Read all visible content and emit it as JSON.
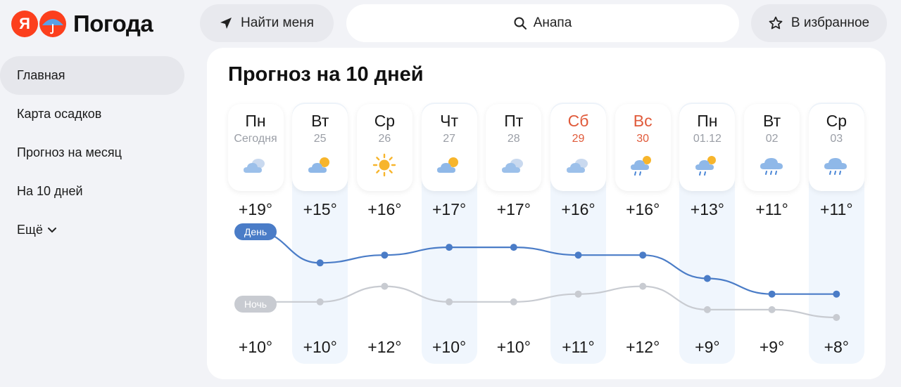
{
  "header": {
    "logo_letter": "Я",
    "logo_text": "Погода",
    "find_me": "Найти меня",
    "search_value": "Анапа",
    "favorite": "В избранное"
  },
  "sidebar": {
    "items": [
      {
        "label": "Главная",
        "active": true
      },
      {
        "label": "Карта осадков"
      },
      {
        "label": "Прогноз на месяц"
      },
      {
        "label": "На 10 дней"
      },
      {
        "label": "Ещё"
      }
    ]
  },
  "forecast": {
    "title": "Прогноз на 10 дней",
    "day_tag": "День",
    "night_tag": "Ночь",
    "colors": {
      "day_line": "#4a7cc7",
      "night_line": "#c8cbd1",
      "weekend": "#e05a3a",
      "column_bg": "#f0f6fd"
    },
    "days": [
      {
        "name": "Пн",
        "date": "Сегодня",
        "icon": "cloudy-icon",
        "hi": "+19°",
        "lo": "+10°",
        "hi_val": 19,
        "lo_val": 10
      },
      {
        "name": "Вт",
        "date": "25",
        "icon": "partly-cloudy-icon",
        "hi": "+15°",
        "lo": "+10°",
        "hi_val": 15,
        "lo_val": 10,
        "shaded": true
      },
      {
        "name": "Ср",
        "date": "26",
        "icon": "sun-icon",
        "hi": "+16°",
        "lo": "+12°",
        "hi_val": 16,
        "lo_val": 12
      },
      {
        "name": "Чт",
        "date": "27",
        "icon": "partly-cloudy-icon",
        "hi": "+17°",
        "lo": "+10°",
        "hi_val": 17,
        "lo_val": 10,
        "shaded": true
      },
      {
        "name": "Пт",
        "date": "28",
        "icon": "cloudy-icon",
        "hi": "+17°",
        "lo": "+10°",
        "hi_val": 17,
        "lo_val": 10
      },
      {
        "name": "Сб",
        "date": "29",
        "icon": "cloudy-icon",
        "hi": "+16°",
        "lo": "+11°",
        "hi_val": 16,
        "lo_val": 11,
        "weekend": true,
        "shaded": true
      },
      {
        "name": "Вс",
        "date": "30",
        "icon": "partly-cloudy-rain-icon",
        "hi": "+16°",
        "lo": "+12°",
        "hi_val": 16,
        "lo_val": 12,
        "weekend": true
      },
      {
        "name": "Пн",
        "date": "01.12",
        "icon": "partly-cloudy-rain-icon",
        "hi": "+13°",
        "lo": "+9°",
        "hi_val": 13,
        "lo_val": 9,
        "shaded": true
      },
      {
        "name": "Вт",
        "date": "02",
        "icon": "rain-icon",
        "hi": "+11°",
        "lo": "+9°",
        "hi_val": 11,
        "lo_val": 9
      },
      {
        "name": "Ср",
        "date": "03",
        "icon": "rain-icon",
        "hi": "+11°",
        "lo": "+8°",
        "hi_val": 11,
        "lo_val": 8,
        "shaded": true
      }
    ]
  }
}
